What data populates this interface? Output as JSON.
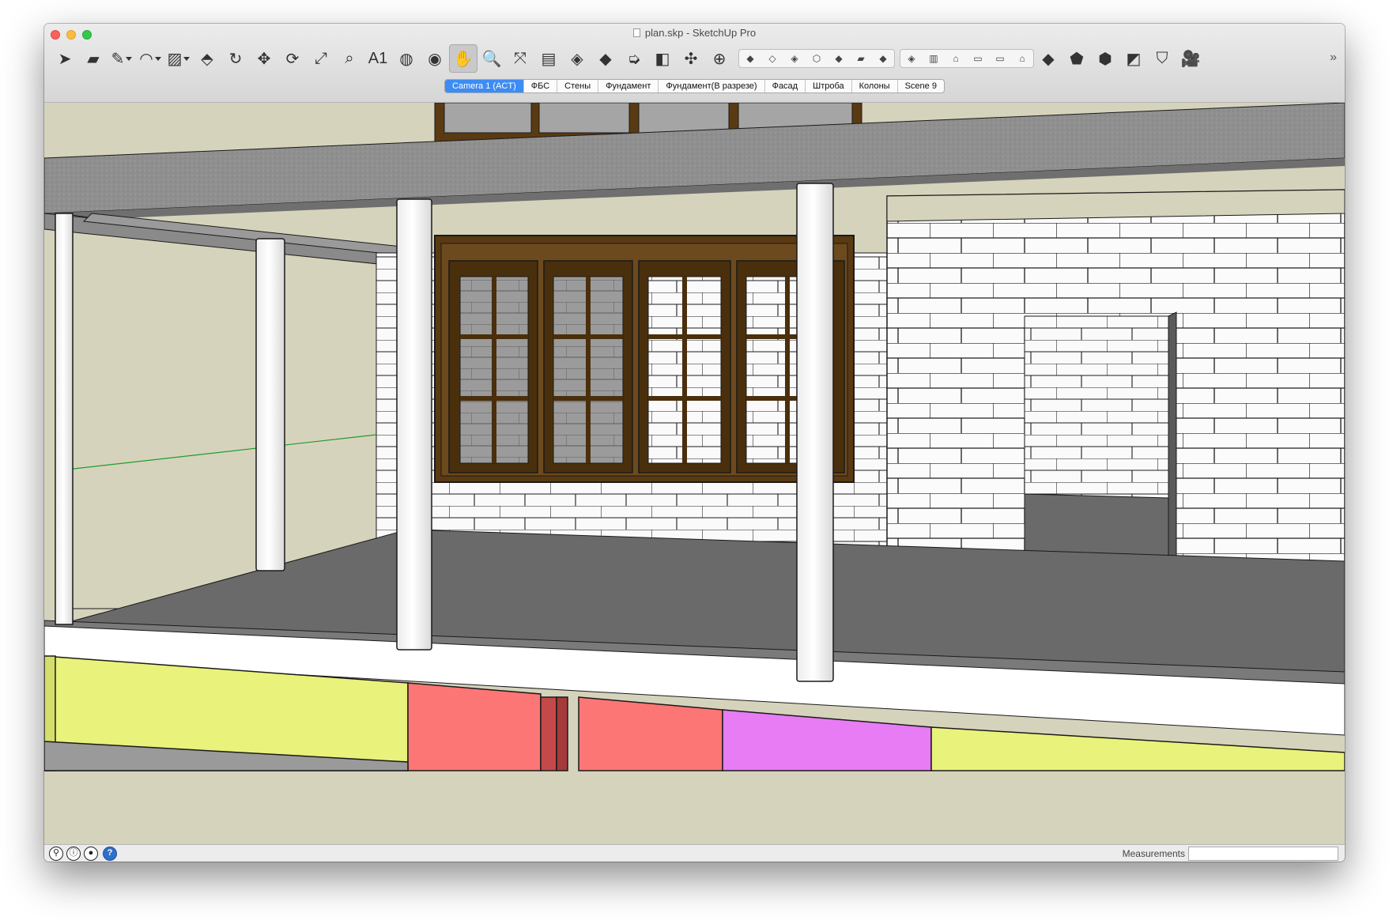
{
  "window": {
    "title": "plan.skp - SketchUp Pro"
  },
  "toolbar": {
    "tools": [
      {
        "name": "select-tool-icon",
        "glyph": "➤"
      },
      {
        "name": "eraser-tool-icon",
        "glyph": "▰"
      },
      {
        "name": "line-tool-icon",
        "glyph": "✎"
      },
      {
        "name": "arc-tool-icon",
        "glyph": "◠"
      },
      {
        "name": "rectangle-tool-icon",
        "glyph": "▨"
      },
      {
        "name": "push-pull-tool-icon",
        "glyph": "⬘"
      },
      {
        "name": "follow-me-tool-icon",
        "glyph": "↻"
      },
      {
        "name": "move-tool-icon",
        "glyph": "✥"
      },
      {
        "name": "rotate-tool-icon",
        "glyph": "⟳"
      },
      {
        "name": "scale-tool-icon",
        "glyph": "⤢"
      },
      {
        "name": "tape-measure-tool-icon",
        "glyph": "⌕"
      },
      {
        "name": "text-tool-icon",
        "glyph": "A1"
      },
      {
        "name": "paint-bucket-tool-icon",
        "glyph": "◍"
      },
      {
        "name": "orbit-tool-icon",
        "glyph": "◉"
      },
      {
        "name": "pan-tool-icon",
        "glyph": "✋"
      },
      {
        "name": "zoom-tool-icon",
        "glyph": "🔍"
      },
      {
        "name": "zoom-extents-tool-icon",
        "glyph": "⤧"
      },
      {
        "name": "warehouse-icon",
        "glyph": "▤"
      },
      {
        "name": "extension-warehouse-icon",
        "glyph": "◈"
      },
      {
        "name": "components-icon",
        "glyph": "◆"
      },
      {
        "name": "send-to-layout-icon",
        "glyph": "➭"
      },
      {
        "name": "section-plane-icon",
        "glyph": "◧"
      },
      {
        "name": "axes-tool-icon",
        "glyph": "✣"
      },
      {
        "name": "position-camera-icon",
        "glyph": "⊕"
      }
    ],
    "styles": [
      "◆",
      "◇",
      "◈",
      "⬡",
      "◆",
      "▰",
      "◆"
    ],
    "views": [
      "◈",
      "▥",
      "⌂",
      "▭",
      "▭",
      "⌂"
    ],
    "extra": [
      {
        "name": "xray-icon",
        "glyph": "◆"
      },
      {
        "name": "back-edges-icon",
        "glyph": "⬟"
      },
      {
        "name": "wireframe-icon",
        "glyph": "⬢"
      },
      {
        "name": "shaded-icon",
        "glyph": "◩"
      },
      {
        "name": "textured-icon",
        "glyph": "⛉"
      },
      {
        "name": "walkthrough-icon",
        "glyph": "🎥"
      }
    ],
    "overflow": "»"
  },
  "scenes": {
    "tabs": [
      "Camera 1 (ACT)",
      "ФБС",
      "Стены",
      "Фундамент",
      "Фундамент(В разрезе)",
      "Фасад",
      "Штроба",
      "Колоны",
      "Scene 9"
    ],
    "active_index": 0
  },
  "statusbar": {
    "icons": [
      "geo-location-icon",
      "credits-icon",
      "user-icon",
      "help-icon"
    ],
    "icon_glyphs": [
      "⚲",
      "ⓘ",
      "●",
      "?"
    ],
    "measurements_label": "Measurements",
    "measurements_value": ""
  },
  "colors": {
    "accent": "#3d8cf4",
    "wall": "#d6d3bd",
    "slab": "#8e8e8e",
    "floor": "#6a6a6a",
    "window_frame": "#5a3a12",
    "foundation_yellow": "#e9f27a",
    "foundation_red": "#fb7674",
    "foundation_magenta": "#e77cf4"
  }
}
